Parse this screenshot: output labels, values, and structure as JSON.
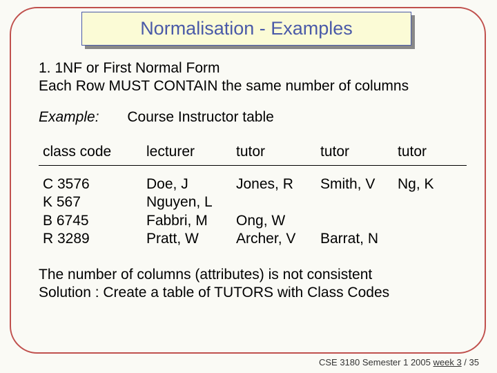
{
  "title": "Normalisation - Examples",
  "body": {
    "line1": "1.   1NF or First Normal Form",
    "line2": "Each Row MUST CONTAIN the same number of columns",
    "example_label": "Example:",
    "example_name": "Course Instructor table",
    "headers": [
      "class code",
      "lecturer",
      "tutor",
      "tutor",
      "tutor"
    ],
    "rows": [
      [
        "C 3576",
        "Doe, J",
        "Jones, R",
        "Smith, V",
        "Ng, K"
      ],
      [
        "K 567",
        "Nguyen, L",
        "",
        "",
        ""
      ],
      [
        "B 6745",
        "Fabbri, M",
        "Ong, W",
        "",
        ""
      ],
      [
        "R 3289",
        "Pratt, W",
        "Archer, V",
        "Barrat, N",
        ""
      ]
    ],
    "summary1": "The number of columns (attributes) is not consistent",
    "summary2": "Solution : Create a table of TUTORS  with Class Codes"
  },
  "footer": {
    "course": "CSE 3180 Semester 1 2005 ",
    "week": " week 3",
    "sep": " / ",
    "total": "35"
  }
}
